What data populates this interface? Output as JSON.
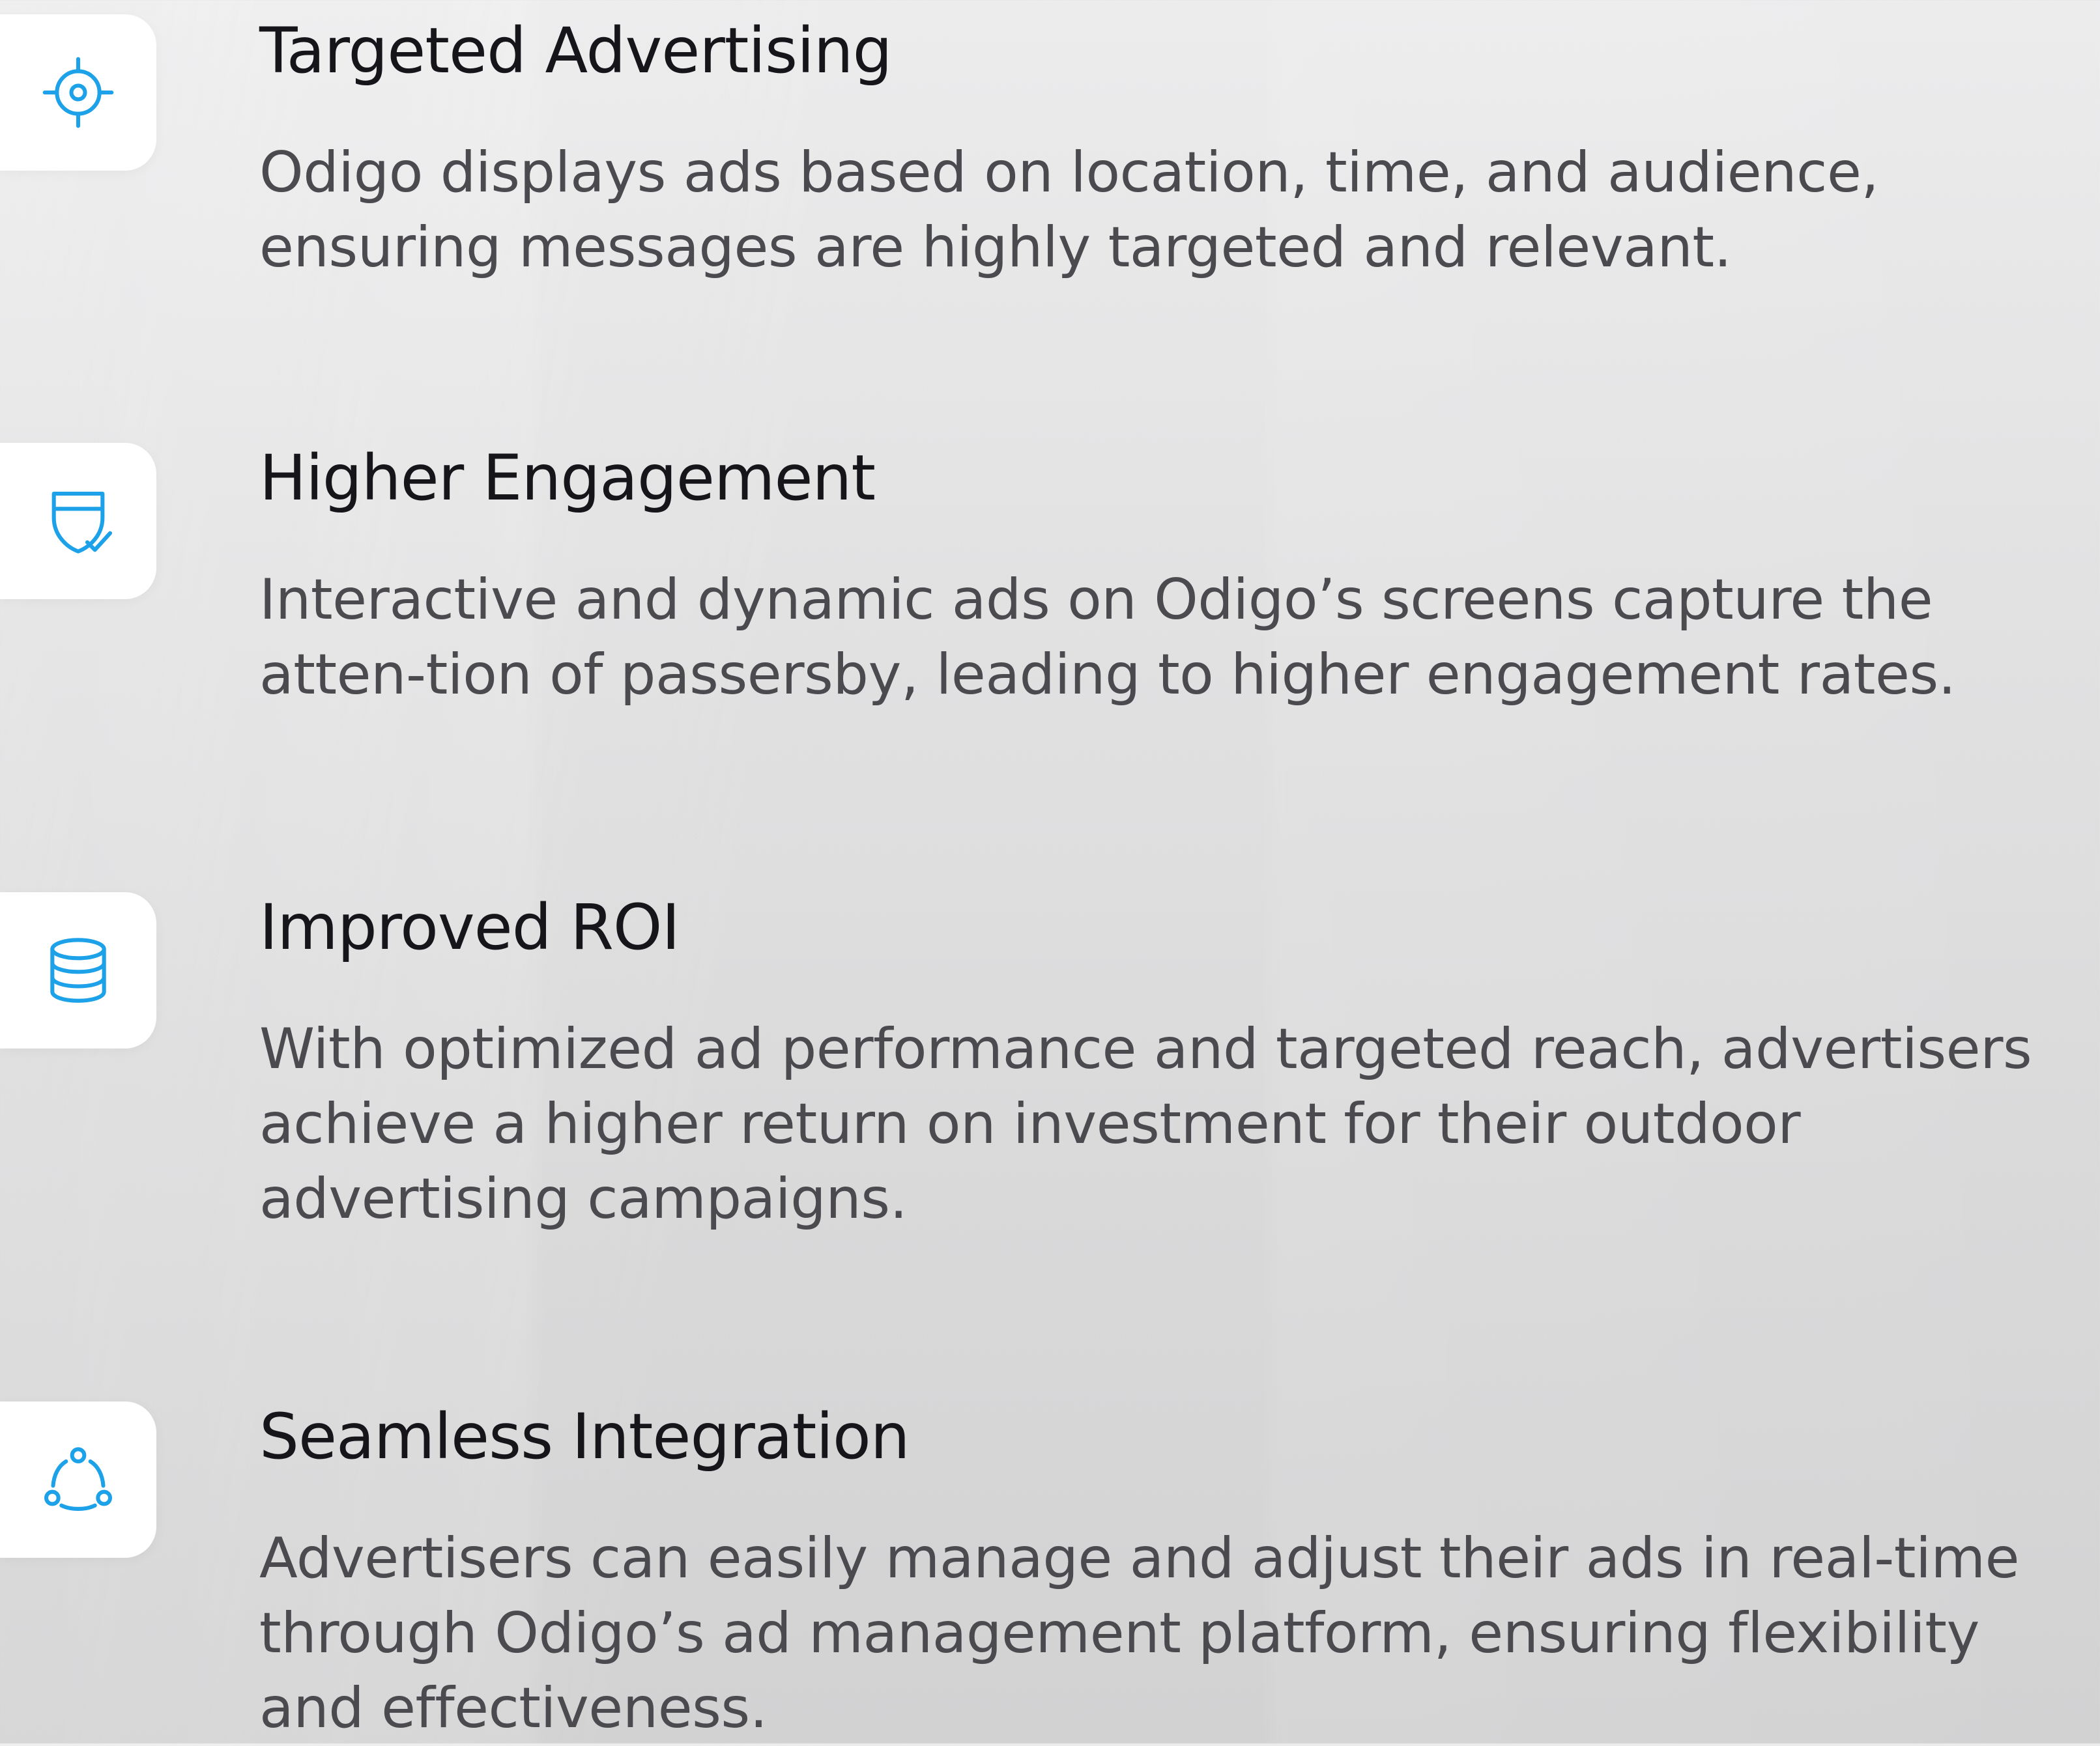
{
  "colors": {
    "accent": "#1da1e8",
    "title": "#15151a",
    "description": "#4a4a4f",
    "tile": "#ffffff"
  },
  "features": [
    {
      "icon": "target-icon",
      "title": "Targeted Advertising",
      "description": "Odigo displays ads based on location, time, and audience, ensuring messages are highly targeted and relevant."
    },
    {
      "icon": "shield-check-icon",
      "title": "Higher Engagement",
      "description": "Interactive and dynamic ads on Odigo’s screens capture the atten-tion of passersby, leading to higher engagement rates."
    },
    {
      "icon": "database-icon",
      "title": "Improved ROI",
      "description": "With optimized ad performance and targeted reach, advertisers achieve a higher return on investment for their outdoor advertising campaigns."
    },
    {
      "icon": "integration-nodes-icon",
      "title": "Seamless Integration",
      "description": "Advertisers can easily manage and adjust their ads in real-time through Odigo’s ad management platform, ensuring flexibility and effectiveness."
    }
  ]
}
